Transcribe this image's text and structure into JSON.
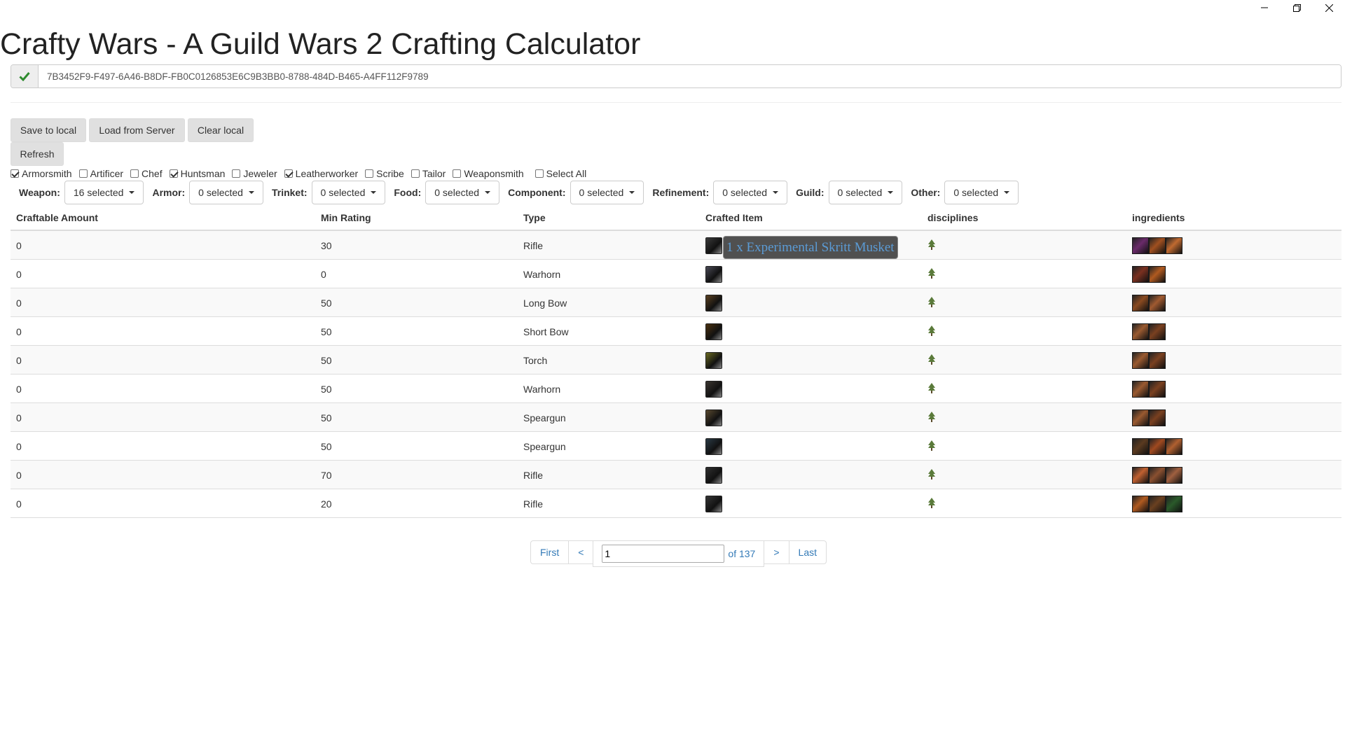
{
  "window": {
    "icons": [
      "minimize-icon",
      "restore-icon",
      "close-icon"
    ]
  },
  "title": "Crafty Wars - A Guild Wars 2 Crafting Calculator",
  "api_key": {
    "value": "7B3452F9-F497-6A46-B8DF-FB0C0126853E6C9B3BB0-8788-484D-B465-A4FF112F9789",
    "status_icon": "check-icon",
    "status_color": "#2e8b2e"
  },
  "buttons": {
    "save_local": "Save to local",
    "load_server": "Load from Server",
    "clear_local": "Clear local",
    "refresh": "Refresh"
  },
  "disciplines": [
    {
      "label": "Armorsmith",
      "checked": true
    },
    {
      "label": "Artificer",
      "checked": false
    },
    {
      "label": "Chef",
      "checked": false
    },
    {
      "label": "Huntsman",
      "checked": true
    },
    {
      "label": "Jeweler",
      "checked": false
    },
    {
      "label": "Leatherworker",
      "checked": true
    },
    {
      "label": "Scribe",
      "checked": false
    },
    {
      "label": "Tailor",
      "checked": false
    },
    {
      "label": "Weaponsmith",
      "checked": false
    },
    {
      "label": "Select All",
      "checked": false
    }
  ],
  "filters": [
    {
      "label": "Weapon:",
      "value": "16 selected"
    },
    {
      "label": "Armor:",
      "value": "0 selected"
    },
    {
      "label": "Trinket:",
      "value": "0 selected"
    },
    {
      "label": "Food:",
      "value": "0 selected"
    },
    {
      "label": "Component:",
      "value": "0 selected"
    },
    {
      "label": "Refinement:",
      "value": "0 selected"
    },
    {
      "label": "Guild:",
      "value": "0 selected"
    },
    {
      "label": "Other:",
      "value": "0 selected"
    }
  ],
  "table": {
    "headers": [
      "Craftable Amount",
      "Min Rating",
      "Type",
      "Crafted Item",
      "disciplines",
      "ingredients"
    ],
    "rows": [
      {
        "amount": "0",
        "rating": "30",
        "type": "Rifle",
        "ing": 3
      },
      {
        "amount": "0",
        "rating": "0",
        "type": "Warhorn",
        "ing": 2
      },
      {
        "amount": "0",
        "rating": "50",
        "type": "Long Bow",
        "ing": 2
      },
      {
        "amount": "0",
        "rating": "50",
        "type": "Short Bow",
        "ing": 2
      },
      {
        "amount": "0",
        "rating": "50",
        "type": "Torch",
        "ing": 2
      },
      {
        "amount": "0",
        "rating": "50",
        "type": "Warhorn",
        "ing": 2
      },
      {
        "amount": "0",
        "rating": "50",
        "type": "Speargun",
        "ing": 2
      },
      {
        "amount": "0",
        "rating": "50",
        "type": "Speargun",
        "ing": 3
      },
      {
        "amount": "0",
        "rating": "70",
        "type": "Rifle",
        "ing": 3
      },
      {
        "amount": "0",
        "rating": "20",
        "type": "Rifle",
        "ing": 3
      }
    ],
    "discipline_icon": "huntsman-tree-icon"
  },
  "tooltip": "1 x Experimental Skritt Musket",
  "pagination": {
    "first": "First",
    "prev": "<",
    "page": "1",
    "of": "of 137",
    "next": ">",
    "last": "Last"
  }
}
